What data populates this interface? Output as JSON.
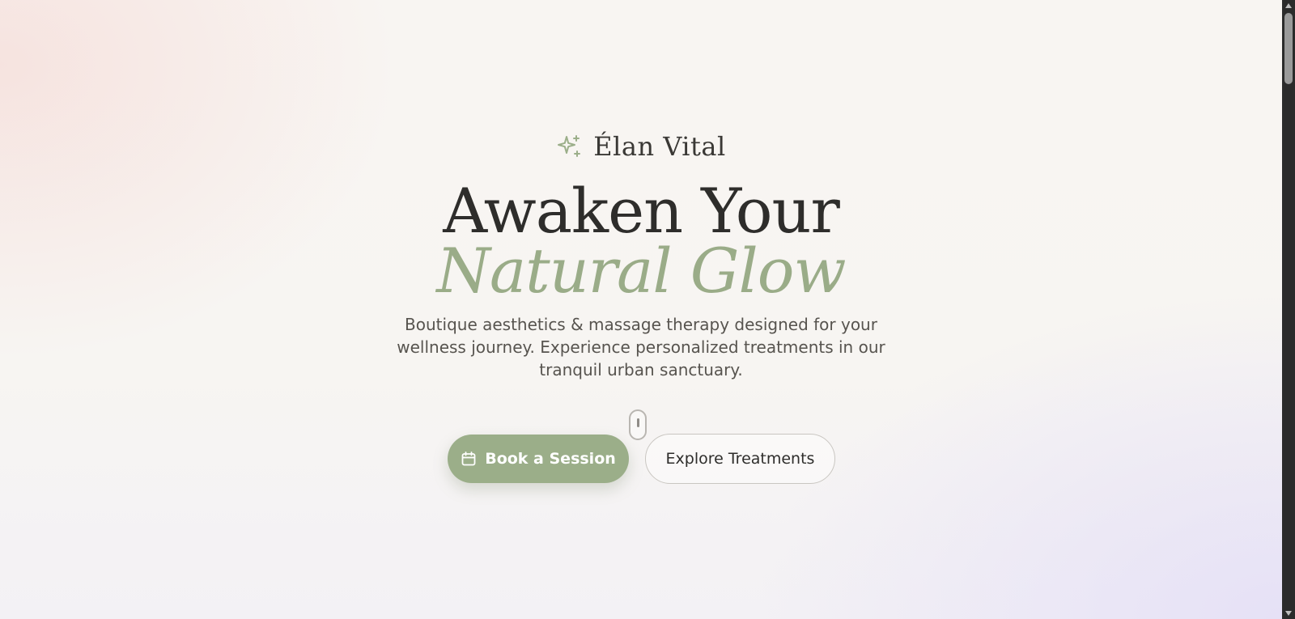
{
  "brand": {
    "icon": "sparkles-icon",
    "name": "Élan Vital"
  },
  "hero": {
    "headline": "Awaken Your",
    "headline_accent": "Natural Glow",
    "subtitle": "Boutique aesthetics & massage therapy designed for your wellness journey. Experience personalized treatments in our tranquil urban sanctuary."
  },
  "actions": {
    "primary": {
      "label": "Book a Session",
      "icon": "calendar-icon"
    },
    "secondary": {
      "label": "Explore Treatments"
    }
  },
  "scroll_indicator": {
    "icon": "mouse-scroll-icon"
  },
  "colors": {
    "accent": "#9bae89",
    "text_dark": "#2e2d2b",
    "text_muted": "#57544f"
  }
}
